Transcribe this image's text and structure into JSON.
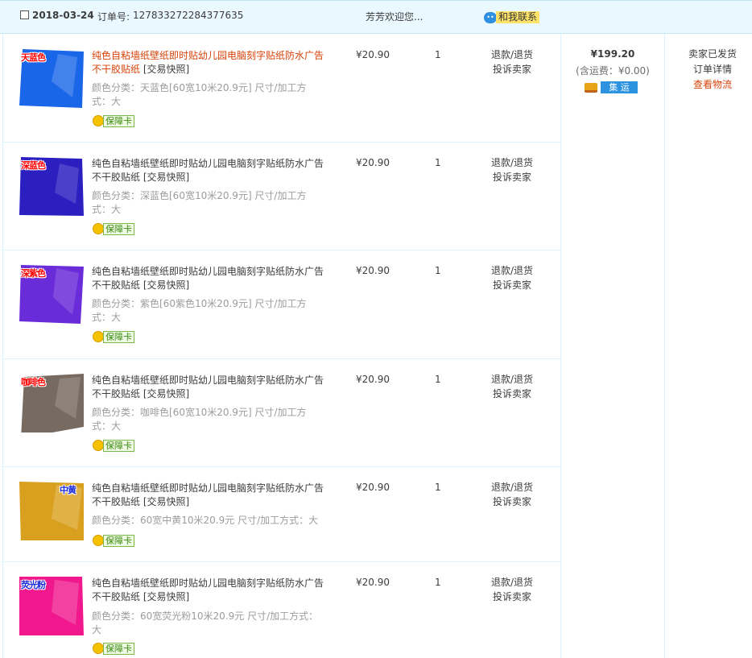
{
  "order": {
    "date": "2018-03-24",
    "order_no_label": "订单号:",
    "order_no": "127833272284377635",
    "shop": "芳芳欢迎您...",
    "contact_label": "和我联系",
    "total": "¥199.20",
    "shipping": "(含运费：¥0.00)",
    "consolidation_label": "集 运",
    "status": "卖家已发货",
    "detail_link": "订单详情",
    "logistics_link": "查看物流"
  },
  "items": [
    {
      "tag": "天蓝色",
      "image_color": "#1a66e8",
      "title": "纯色自粘墙纸壁纸即时贴幼儿园电脑刻字贴纸防水广告不干胶贴纸",
      "snapshot": "[交易快照]",
      "sku": "颜色分类：天蓝色[60宽10米20.9元]  尺寸/加工方式：大",
      "badge": "保障卡",
      "price": "¥20.90",
      "qty": "1",
      "refund": "退款/退货",
      "complain": "投诉卖家"
    },
    {
      "tag": "深蓝色",
      "image_color": "#2b1fc0",
      "title": "纯色自粘墙纸壁纸即时贴幼儿园电脑刻字贴纸防水广告不干胶贴纸",
      "snapshot": "[交易快照]",
      "sku": "颜色分类：深蓝色[60宽10米20.9元]  尺寸/加工方式：大",
      "badge": "保障卡",
      "price": "¥20.90",
      "qty": "1",
      "refund": "退款/退货",
      "complain": "投诉卖家"
    },
    {
      "tag": "深紫色",
      "image_color": "#6a2bd9",
      "title": "纯色自粘墙纸壁纸即时贴幼儿园电脑刻字贴纸防水广告不干胶贴纸",
      "snapshot": "[交易快照]",
      "sku": "颜色分类：紫色[60紫色10米20.9元]  尺寸/加工方式：大",
      "badge": "保障卡",
      "price": "¥20.90",
      "qty": "1",
      "refund": "退款/退货",
      "complain": "投诉卖家"
    },
    {
      "tag": "咖啡色",
      "image_color": "#776a60",
      "title": "纯色自粘墙纸壁纸即时贴幼儿园电脑刻字贴纸防水广告不干胶贴纸",
      "snapshot": "[交易快照]",
      "sku": "颜色分类：咖啡色[60宽10米20.9元]  尺寸/加工方式：大",
      "badge": "保障卡",
      "price": "¥20.90",
      "qty": "1",
      "refund": "退款/退货",
      "complain": "投诉卖家"
    },
    {
      "tag": "中黄",
      "image_color": "#d9a01f",
      "title": "纯色自粘墙纸壁纸即时贴幼儿园电脑刻字贴纸防水广告不干胶贴纸",
      "snapshot": "[交易快照]",
      "sku": "颜色分类：60宽中黄10米20.9元  尺寸/加工方式：大",
      "badge": "保障卡",
      "price": "¥20.90",
      "qty": "1",
      "refund": "退款/退货",
      "complain": "投诉卖家"
    },
    {
      "tag": "荧光粉",
      "image_color": "#f0188c",
      "title": "纯色自粘墙纸壁纸即时贴幼儿园电脑刻字贴纸防水广告不干胶贴纸",
      "snapshot": "[交易快照]",
      "sku": "颜色分类：60宽荧光粉10米20.9元  尺寸/加工方式：大",
      "badge": "保障卡",
      "price": "¥20.90",
      "qty": "1",
      "refund": "退款/退货",
      "complain": "投诉卖家"
    }
  ]
}
